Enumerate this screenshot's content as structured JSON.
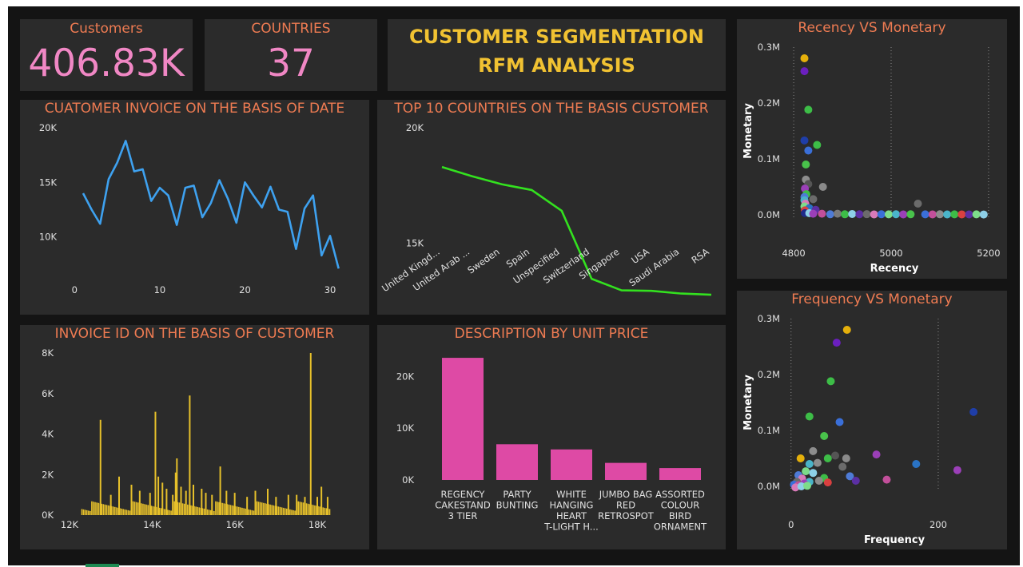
{
  "kpis": {
    "customers": {
      "label": "Customers",
      "value": "406.83K"
    },
    "countries": {
      "label": "COUNTRIES",
      "value": "37"
    }
  },
  "header": {
    "line1": "CUSTOMER SEGMENTATION",
    "line2": "RFM ANALYSIS"
  },
  "colors": {
    "background": "#141414",
    "panel": "#2b2b2b",
    "title": "#ee7b52",
    "kpi_value": "#f087c4",
    "header": "#f1c232"
  },
  "chart_data": [
    {
      "id": "invoice_by_date",
      "type": "line",
      "title": "CUATOMER INVOICE ON THE BASIS OF DATE",
      "xlabel": "",
      "ylabel": "",
      "color": "#3ea1ef",
      "ylim": [
        5000,
        20000
      ],
      "xlim": [
        -2,
        33
      ],
      "yticks": [
        {
          "v": 10000,
          "label": "10K"
        },
        {
          "v": 15000,
          "label": "15K"
        },
        {
          "v": 20000,
          "label": "20K"
        }
      ],
      "xticks": [
        0,
        10,
        20,
        30
      ],
      "x": [
        1,
        2,
        3,
        4,
        5,
        6,
        7,
        8,
        9,
        10,
        11,
        12,
        13,
        14,
        15,
        16,
        17,
        18,
        19,
        20,
        21,
        22,
        23,
        24,
        25,
        26,
        27,
        28,
        29,
        30,
        31
      ],
      "values": [
        14000,
        12500,
        11200,
        15300,
        16800,
        18800,
        16000,
        16200,
        13300,
        14500,
        13800,
        11100,
        14500,
        14700,
        11800,
        13100,
        15200,
        13500,
        11300,
        15000,
        13800,
        12700,
        14600,
        12500,
        12300,
        8900,
        12600,
        13800,
        8300,
        10100,
        7100
      ]
    },
    {
      "id": "top10_countries",
      "type": "line",
      "title": "TOP 10 COUNTRIES ON THE BASIS CUSTOMER",
      "xlabel": "",
      "ylabel": "",
      "color": "#33e11f",
      "ylim": [
        12000,
        20000
      ],
      "yticks": [
        {
          "v": 15000,
          "label": "15K"
        },
        {
          "v": 20000,
          "label": "20K"
        }
      ],
      "categories": [
        "United Kingd...",
        "United Arab ...",
        "Sweden",
        "Spain",
        "Unspecified",
        "Switzerland",
        "Singapore",
        "USA",
        "Saudi Arabia",
        "RSA"
      ],
      "values": [
        18300,
        17900,
        17550,
        17300,
        16400,
        13450,
        12950,
        12930,
        12810,
        12760
      ]
    },
    {
      "id": "recency_vs_monetary",
      "type": "scatter",
      "title": "Recency VS Monetary",
      "xlabel": "Recency",
      "ylabel": "Monetary",
      "xlim": [
        4790,
        5210
      ],
      "ylim": [
        -20000,
        300000
      ],
      "xticks": [
        {
          "v": 4800,
          "label": "4800"
        },
        {
          "v": 5000,
          "label": "5000"
        },
        {
          "v": 5200,
          "label": "5200"
        }
      ],
      "yticks": [
        {
          "v": 0,
          "label": "0.0M"
        },
        {
          "v": 100000,
          "label": "0.1M"
        },
        {
          "v": 200000,
          "label": "0.2M"
        },
        {
          "v": 300000,
          "label": "0.3M"
        }
      ],
      "points": [
        {
          "x": 4822,
          "y": 280000,
          "c": "#e5b00b"
        },
        {
          "x": 4822,
          "y": 257000,
          "c": "#6b1fbf"
        },
        {
          "x": 4830,
          "y": 188000,
          "c": "#3dbd47"
        },
        {
          "x": 4822,
          "y": 133000,
          "c": "#1f3ea8"
        },
        {
          "x": 4848,
          "y": 125000,
          "c": "#3dbd47"
        },
        {
          "x": 4830,
          "y": 115000,
          "c": "#3a6fd8"
        },
        {
          "x": 4825,
          "y": 90000,
          "c": "#49c24b"
        },
        {
          "x": 4825,
          "y": 63000,
          "c": "#8d8d8d"
        },
        {
          "x": 4830,
          "y": 55000,
          "c": "#555555"
        },
        {
          "x": 4860,
          "y": 50000,
          "c": "#8a8a8a"
        },
        {
          "x": 4823,
          "y": 47000,
          "c": "#9b3fb8"
        },
        {
          "x": 4826,
          "y": 37000,
          "c": "#3dbd47"
        },
        {
          "x": 4822,
          "y": 32000,
          "c": "#4e7bd6"
        },
        {
          "x": 4822,
          "y": 26000,
          "c": "#4ab4c9"
        },
        {
          "x": 4840,
          "y": 28000,
          "c": "#6b6b6b"
        },
        {
          "x": 4824,
          "y": 20000,
          "c": "#d97ab9"
        },
        {
          "x": 4822,
          "y": 15000,
          "c": "#7ddc8a"
        },
        {
          "x": 4832,
          "y": 12000,
          "c": "#2a73c4"
        },
        {
          "x": 4845,
          "y": 9000,
          "c": "#5b2fa3"
        },
        {
          "x": 4823,
          "y": 8000,
          "c": "#d94040"
        },
        {
          "x": 4823,
          "y": 3000,
          "c": "#1f2a8a"
        },
        {
          "x": 4832,
          "y": 3000,
          "c": "#8ed0e8"
        },
        {
          "x": 4840,
          "y": 2000,
          "c": "#9b3fb8"
        },
        {
          "x": 4858,
          "y": 2000,
          "c": "#c24f9a"
        },
        {
          "x": 4875,
          "y": 1000,
          "c": "#4e7bd6"
        },
        {
          "x": 4890,
          "y": 2000,
          "c": "#7a7a7a"
        },
        {
          "x": 4905,
          "y": 1000,
          "c": "#3dbd47"
        },
        {
          "x": 4920,
          "y": 1500,
          "c": "#8ed0e8"
        },
        {
          "x": 4935,
          "y": 1000,
          "c": "#5b2fa3"
        },
        {
          "x": 4950,
          "y": 1200,
          "c": "#6b6b6b"
        },
        {
          "x": 4965,
          "y": 800,
          "c": "#d97ab9"
        },
        {
          "x": 4980,
          "y": 1000,
          "c": "#3a6fd8"
        },
        {
          "x": 4995,
          "y": 900,
          "c": "#7ddc8a"
        },
        {
          "x": 5010,
          "y": 1100,
          "c": "#4ab4c9"
        },
        {
          "x": 5025,
          "y": 800,
          "c": "#9b3fb8"
        },
        {
          "x": 5040,
          "y": 1000,
          "c": "#49c24b"
        },
        {
          "x": 5055,
          "y": 20000,
          "c": "#6b6b6b"
        },
        {
          "x": 5070,
          "y": 900,
          "c": "#3a6fd8"
        },
        {
          "x": 5085,
          "y": 800,
          "c": "#c24f9a"
        },
        {
          "x": 5100,
          "y": 1000,
          "c": "#8d8d8d"
        },
        {
          "x": 5115,
          "y": 700,
          "c": "#4ab4c9"
        },
        {
          "x": 5130,
          "y": 900,
          "c": "#3dbd47"
        },
        {
          "x": 5145,
          "y": 800,
          "c": "#d94040"
        },
        {
          "x": 5160,
          "y": 700,
          "c": "#5b2fa3"
        },
        {
          "x": 5175,
          "y": 900,
          "c": "#7ddc8a"
        },
        {
          "x": 5190,
          "y": 600,
          "c": "#8ed0e8"
        }
      ]
    },
    {
      "id": "frequency_vs_monetary",
      "type": "scatter",
      "title": "Frequency VS Monetary",
      "xlabel": "Frequency",
      "ylabel": "Monetary",
      "xlim": [
        -3,
        275
      ],
      "ylim": [
        -20000,
        300000
      ],
      "xticks": [
        {
          "v": 0,
          "label": "0"
        },
        {
          "v": 200,
          "label": "200"
        }
      ],
      "yticks": [
        {
          "v": 0,
          "label": "0.0M"
        },
        {
          "v": 100000,
          "label": "0.1M"
        },
        {
          "v": 200000,
          "label": "0.2M"
        },
        {
          "v": 300000,
          "label": "0.3M"
        }
      ],
      "points": [
        {
          "x": 76,
          "y": 280000,
          "c": "#e5b00b"
        },
        {
          "x": 62,
          "y": 257000,
          "c": "#6b1fbf"
        },
        {
          "x": 54,
          "y": 188000,
          "c": "#3dbd47"
        },
        {
          "x": 248,
          "y": 133000,
          "c": "#1f3ea8"
        },
        {
          "x": 25,
          "y": 125000,
          "c": "#3dbd47"
        },
        {
          "x": 66,
          "y": 115000,
          "c": "#3a6fd8"
        },
        {
          "x": 45,
          "y": 90000,
          "c": "#49c24b"
        },
        {
          "x": 30,
          "y": 63000,
          "c": "#8d8d8d"
        },
        {
          "x": 116,
          "y": 57000,
          "c": "#9b3fb8"
        },
        {
          "x": 75,
          "y": 50000,
          "c": "#8a8a8a"
        },
        {
          "x": 170,
          "y": 40000,
          "c": "#2a73c4"
        },
        {
          "x": 13,
          "y": 50000,
          "c": "#e5b00b"
        },
        {
          "x": 50,
          "y": 50000,
          "c": "#3dbd47"
        },
        {
          "x": 60,
          "y": 55000,
          "c": "#555555"
        },
        {
          "x": 25,
          "y": 40000,
          "c": "#4ab4c9"
        },
        {
          "x": 36,
          "y": 42000,
          "c": "#8d8d8d"
        },
        {
          "x": 70,
          "y": 35000,
          "c": "#6b6b6b"
        },
        {
          "x": 226,
          "y": 29000,
          "c": "#9b3fb8"
        },
        {
          "x": 20,
          "y": 27000,
          "c": "#7ddc8a"
        },
        {
          "x": 10,
          "y": 20000,
          "c": "#4e7bd6"
        },
        {
          "x": 30,
          "y": 24000,
          "c": "#8ed0e8"
        },
        {
          "x": 80,
          "y": 18000,
          "c": "#4e7bd6"
        },
        {
          "x": 88,
          "y": 10000,
          "c": "#5b2fa3"
        },
        {
          "x": 130,
          "y": 12000,
          "c": "#c24f9a"
        },
        {
          "x": 15,
          "y": 14000,
          "c": "#d97ab9"
        },
        {
          "x": 45,
          "y": 15000,
          "c": "#3dbd47"
        },
        {
          "x": 8,
          "y": 8000,
          "c": "#6b6b6b"
        },
        {
          "x": 25,
          "y": 8000,
          "c": "#4ab4c9"
        },
        {
          "x": 18,
          "y": 5000,
          "c": "#9b3fb8"
        },
        {
          "x": 38,
          "y": 10000,
          "c": "#8d8d8d"
        },
        {
          "x": 50,
          "y": 7000,
          "c": "#d94040"
        },
        {
          "x": 4,
          "y": 3000,
          "c": "#3a6fd8"
        },
        {
          "x": 10,
          "y": 2000,
          "c": "#c24f9a"
        },
        {
          "x": 6,
          "y": -2000,
          "c": "#d97ab9"
        },
        {
          "x": 14,
          "y": 0,
          "c": "#8ed0e8"
        },
        {
          "x": 22,
          "y": 1000,
          "c": "#7ddc8a"
        }
      ]
    },
    {
      "id": "invoice_by_customer",
      "type": "bar",
      "title": "INVOICE ID ON THE BASIS OF CUSTOMER",
      "xlabel": "",
      "ylabel": "",
      "color": "#e6c02b",
      "xlim": [
        12300,
        18300
      ],
      "ylim": [
        0,
        8000
      ],
      "xticks": [
        {
          "v": 12000,
          "label": "12K"
        },
        {
          "v": 14000,
          "label": "14K"
        },
        {
          "v": 16000,
          "label": "16K"
        },
        {
          "v": 18000,
          "label": "18K"
        }
      ],
      "yticks": [
        {
          "v": 0,
          "label": "0K"
        },
        {
          "v": 2000,
          "label": "2K"
        },
        {
          "v": 4000,
          "label": "4K"
        },
        {
          "v": 6000,
          "label": "6K"
        },
        {
          "v": 8000,
          "label": "8K"
        }
      ],
      "spikes": [
        {
          "x": 12750,
          "y": 4700
        },
        {
          "x": 13000,
          "y": 1000
        },
        {
          "x": 13200,
          "y": 1900
        },
        {
          "x": 13500,
          "y": 1500
        },
        {
          "x": 13700,
          "y": 1200
        },
        {
          "x": 13950,
          "y": 1100
        },
        {
          "x": 14080,
          "y": 5100
        },
        {
          "x": 14150,
          "y": 1900
        },
        {
          "x": 14250,
          "y": 1600
        },
        {
          "x": 14350,
          "y": 1300
        },
        {
          "x": 14500,
          "y": 1000
        },
        {
          "x": 14570,
          "y": 2100
        },
        {
          "x": 14600,
          "y": 2800
        },
        {
          "x": 14700,
          "y": 1400
        },
        {
          "x": 14820,
          "y": 1200
        },
        {
          "x": 14911,
          "y": 5900
        },
        {
          "x": 15000,
          "y": 1500
        },
        {
          "x": 15200,
          "y": 1300
        },
        {
          "x": 15300,
          "y": 1100
        },
        {
          "x": 15450,
          "y": 1000
        },
        {
          "x": 15650,
          "y": 2400
        },
        {
          "x": 15800,
          "y": 1200
        },
        {
          "x": 16000,
          "y": 1100
        },
        {
          "x": 16300,
          "y": 900
        },
        {
          "x": 16500,
          "y": 1200
        },
        {
          "x": 16800,
          "y": 1300
        },
        {
          "x": 17000,
          "y": 900
        },
        {
          "x": 17300,
          "y": 1000
        },
        {
          "x": 17500,
          "y": 1000
        },
        {
          "x": 17700,
          "y": 900
        },
        {
          "x": 17841,
          "y": 8000
        },
        {
          "x": 18000,
          "y": 900
        },
        {
          "x": 18100,
          "y": 1400
        },
        {
          "x": 18250,
          "y": 900
        }
      ]
    },
    {
      "id": "description_by_unit_price",
      "type": "bar",
      "title": "DESCRIPTION BY UNIT PRICE",
      "xlabel": "",
      "ylabel": "",
      "color": "#de4aa5",
      "ylim": [
        0,
        25000
      ],
      "yticks": [
        {
          "v": 0,
          "label": "0K"
        },
        {
          "v": 10000,
          "label": "10K"
        },
        {
          "v": 20000,
          "label": "20K"
        }
      ],
      "categories": [
        [
          "REGENCY",
          "CAKESTAND",
          "3 TIER"
        ],
        [
          "PARTY",
          "BUNTING"
        ],
        [
          "WHITE",
          "HANGING",
          "HEART",
          "T-LIGHT H..."
        ],
        [
          "JUMBO BAG",
          "RED",
          "RETROSPOT"
        ],
        [
          "ASSORTED",
          "COLOUR",
          "BIRD",
          "ORNAMENT"
        ]
      ],
      "values": [
        23600,
        6900,
        5900,
        3300,
        2300
      ]
    }
  ]
}
